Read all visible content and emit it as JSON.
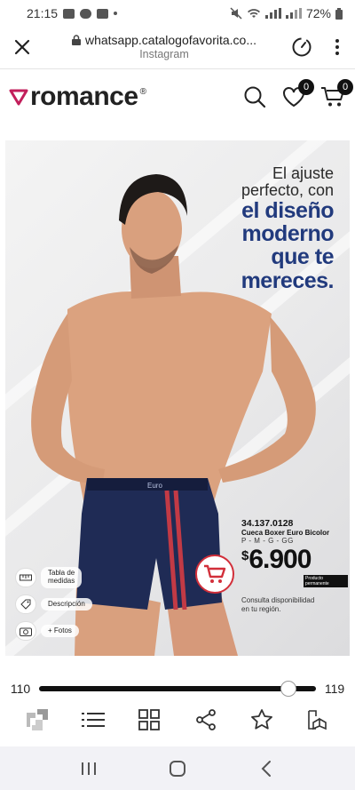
{
  "status": {
    "time": "21:15",
    "battery": "72%"
  },
  "browser": {
    "url": "whatsapp.catalogofavorita.co...",
    "source": "Instagram"
  },
  "brand": {
    "name": "romance",
    "reg_mark": "®"
  },
  "header": {
    "wishlist_count": "0",
    "cart_count": "0"
  },
  "catalog": {
    "headline_line1": "El ajuste",
    "headline_line2": "perfecto, con",
    "headline_line3": "el diseño",
    "headline_line4": "moderno",
    "headline_line5": "que te",
    "headline_line6": "mereces.",
    "waistband_text": "Euro",
    "sku": "34.137.0128",
    "product_name": "Cueca Boxer Euro Bicolor",
    "sizes": "P - M - G - GG",
    "currency": "$",
    "price": "6.900",
    "price_tag": "Producto permanente",
    "consult_line1": "Consulta disponibilidad",
    "consult_line2": "en tu región.",
    "btn_sizes_line1": "Tabla de",
    "btn_sizes_line2": "medidas",
    "btn_description": "Descripción",
    "btn_photos": "+ Fotos"
  },
  "slider": {
    "min_label": "110",
    "max_label": "119",
    "position": 0.9
  },
  "icons": {
    "close": "close-icon",
    "lock": "lock-icon",
    "speed": "speed-icon",
    "menu": "kebab-menu-icon",
    "search": "search-icon",
    "heart": "heart-icon",
    "cart": "cart-icon",
    "logo": "app-logo-icon",
    "list": "list-icon",
    "grid": "grid-icon",
    "share": "share-icon",
    "star": "star-icon",
    "box": "box-icon",
    "recents": "recents-icon",
    "home": "home-icon",
    "back": "back-icon"
  },
  "colors": {
    "accent_red": "#d22f3a",
    "headline_blue": "#213a7d",
    "brand_pink": "#c21f5b",
    "boxer_navy": "#1f2b55"
  }
}
